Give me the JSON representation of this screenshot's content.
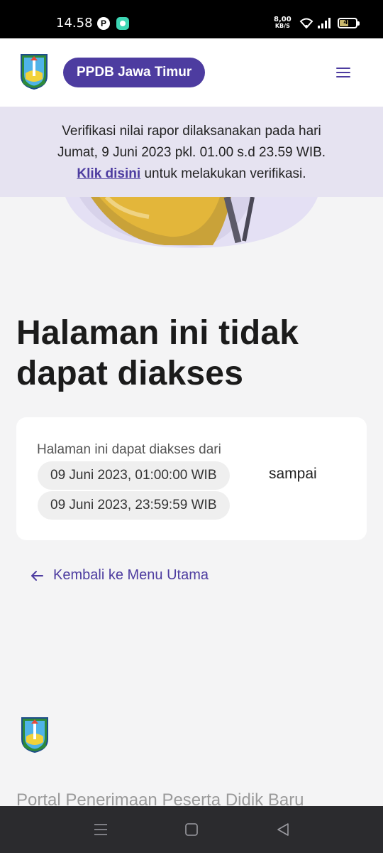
{
  "status_bar": {
    "time": "14.58",
    "speed_value": "8,00",
    "speed_unit": "KB/S",
    "battery": "49",
    "battery_level": 0.49
  },
  "header": {
    "brand_label": "PPDB Jawa Timur",
    "menu_icon": "hamburger-icon"
  },
  "banner": {
    "line1": "Verifikasi nilai rapor dilaksanakan pada hari",
    "line2": "Jumat, 9 Juni 2023 pkl. 01.00 s.d 23.59 WIB.",
    "link_text": "Klik disini",
    "line3_rest": " untuk melakukan verifikasi."
  },
  "page": {
    "title": "Halaman ini tidak dapat diakses"
  },
  "card": {
    "intro": "Halaman ini dapat diakses dari",
    "start": "09 Juni 2023, 01:00:00 WIB",
    "separator": "sampai",
    "end": "09 Juni 2023, 23:59:59 WIB"
  },
  "back_link": {
    "label": "Kembali ke Menu Utama"
  },
  "footer": {
    "portal_text": "Portal Penerimaan Peserta Didik Baru"
  },
  "colors": {
    "brand": "#4d3ca0",
    "banner_bg": "#e6e3f1",
    "page_bg": "#f4f4f5"
  }
}
